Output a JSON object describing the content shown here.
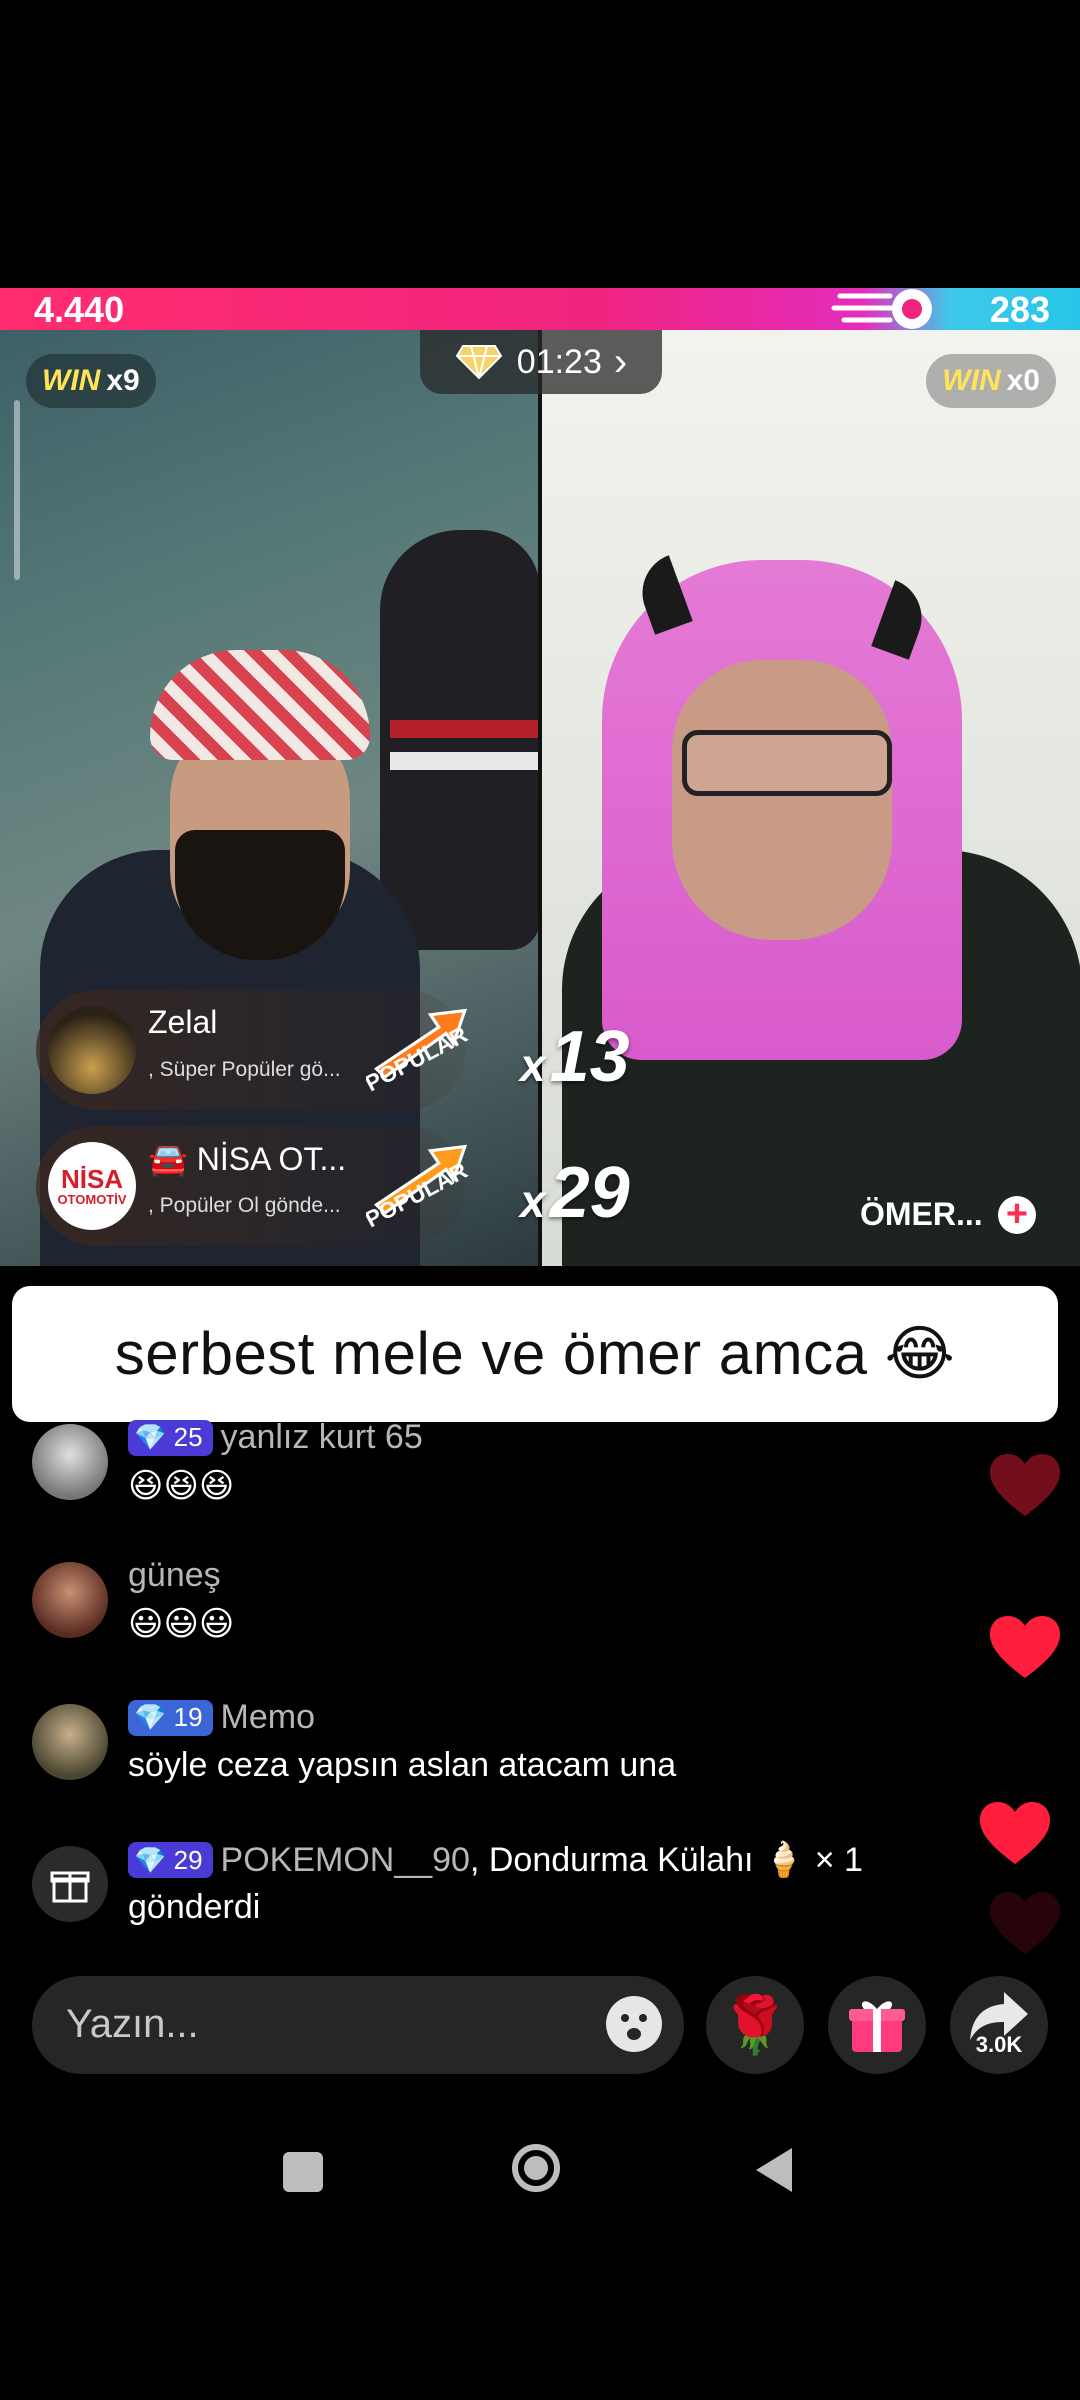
{
  "battle": {
    "left_score": "4.440",
    "right_score": "283",
    "left_score_fraction": 0.94,
    "timer": "01:23",
    "left_win_word": "WIN",
    "left_win_mult": "x9",
    "right_win_word": "WIN",
    "right_win_mult": "x0",
    "right_host_name": "ÖMER..."
  },
  "gifts": [
    {
      "sender": "Zelal",
      "subtitle": ", Süper Popüler  gö...",
      "badge": "POPULAR",
      "combo_prefix": "x",
      "combo": "13"
    },
    {
      "sender": "🚘 NİSA OT...",
      "subtitle": ", Popüler Ol  gönde...",
      "badge": "POPULAR",
      "combo_prefix": "x",
      "combo": "29",
      "avatar_logo_top": "NİSA",
      "avatar_logo_bottom": "OTOMOTİV"
    }
  ],
  "caption": "serbest mele ve ömer amca 😂",
  "comments": [
    {
      "level": "25",
      "level_color": "#4b3bd6",
      "user": "yanlız kurt 65",
      "text": "😆😆😆"
    },
    {
      "level": "",
      "user": "güneş",
      "text": "😃😃😃"
    },
    {
      "level": "19",
      "level_color": "#3c66d8",
      "user": "Memo",
      "text": "söyle ceza yapsın aslan atacam una"
    },
    {
      "level": "29",
      "level_color": "#4b3bd6",
      "user": "POKEMON__90",
      "gift_text": ", Dondurma Külahı 🍦 × 1",
      "text": "gönderdi"
    }
  ],
  "input": {
    "placeholder": "Yazın..."
  },
  "share": {
    "count": "3.0K"
  },
  "icons": {
    "emoji": "smile-icon",
    "rose": "rose-icon",
    "gift": "gift-icon",
    "share": "share-arrow-icon",
    "nav_recent": "square-icon",
    "nav_home": "circle-icon",
    "nav_back": "triangle-back-icon"
  },
  "colors": {
    "left_team": "#f0247f",
    "right_team": "#28c5e8",
    "win": "#ffe45a",
    "heart": "#ff1f3d"
  }
}
